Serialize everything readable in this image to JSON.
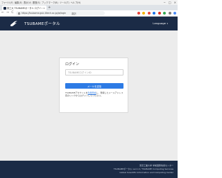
{
  "os_menubar": {
    "items": [
      "ファイル(F)",
      "編集(E)",
      "表示(V)",
      "履歴(S)",
      "ブックマーク(B)",
      "ツール(T)",
      "ヘルプ(H)"
    ],
    "window_controls": [
      "−",
      "□",
      "×"
    ]
  },
  "browser": {
    "tab_title": "東工大 TSUBAMEポータル ログイン",
    "tab_close": "×",
    "new_tab": "+",
    "url": "https://tsubame.gsic.titech.ac.jp/ja/login",
    "translate_label": "翻訳",
    "nav": {
      "back": "←",
      "forward": "→",
      "reload": "C"
    },
    "extension_colors": [
      "#e8453c",
      "#f4b400",
      "#e8453c",
      "#1a73e8",
      "#d93025",
      "#34a853",
      "#7b7b7b",
      "#4c8bf5"
    ]
  },
  "header": {
    "site_title": "TSUBAMEポータル",
    "language_label": "Language",
    "language_caret": "▾",
    "bg_color": "#1b2b46"
  },
  "login": {
    "title": "ログイン",
    "id_placeholder": "TSUBAMEログインID",
    "button_label": "メールを送信",
    "notice_prefix": "TSUBAMEアカウントを",
    "notice_link": "利用申請",
    "notice_suffix": "し、登録したメールアドレス宛のリンクからログインしてください。",
    "button_color": "#2d7be5"
  },
  "footer": {
    "lines": [
      "東京工業大学 学術国際情報センター",
      "TSUBAMEポータル ver.1.0 / TSUBAME Computing Services",
      "Global Scientific Information and Computing Center"
    ]
  }
}
